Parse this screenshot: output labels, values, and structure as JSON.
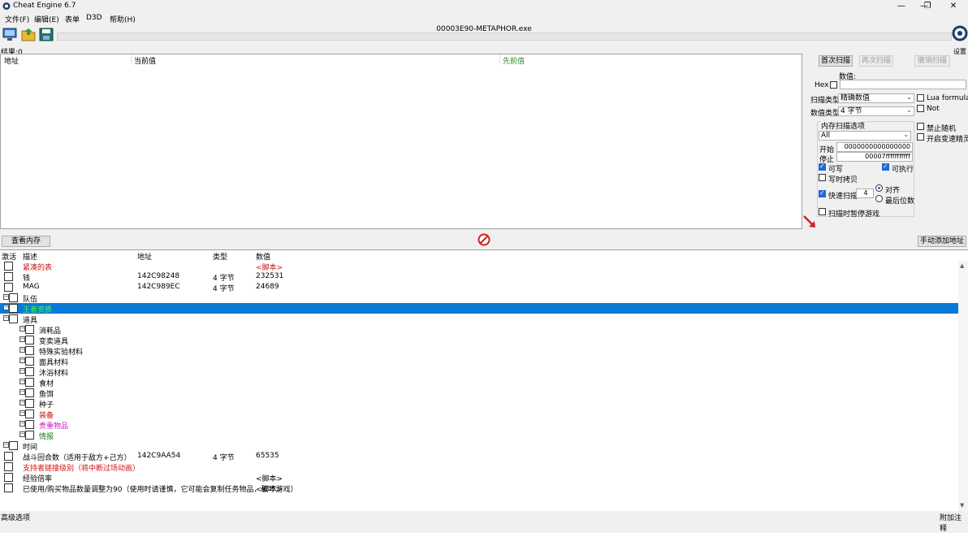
{
  "window": {
    "title": "Cheat Engine 6.7"
  },
  "menu": [
    "文件(F)",
    "编辑(E)",
    "表单",
    "D3D",
    "帮助(H)"
  ],
  "toolbar": {
    "process_name": "00003E90-METAPHOR.exe",
    "settings_label": "设置"
  },
  "results": {
    "count_label": "结果:0",
    "columns": [
      "地址",
      "当前值",
      "先前值"
    ]
  },
  "scan": {
    "first_scan": "首次扫描",
    "next_scan": "再次扫描",
    "undo_scan": "撤销扫描",
    "value_label": "数值:",
    "hex_label": "Hex",
    "scan_type_label": "扫描类型",
    "scan_type_value": "精确数值",
    "value_type_label": "数值类型",
    "value_type_value": "4 字节",
    "lua_formula": "Lua formula",
    "not_label": "Not",
    "no_random": "禁止随机",
    "speedhack": "开启变速精灵",
    "mem_options_title": "内存扫描选项",
    "mem_region": "All",
    "start_label": "开始",
    "start_value": "0000000000000000",
    "stop_label": "停止",
    "stop_value": "00007fffffffffff",
    "writable": "可写",
    "executable": "可执行",
    "copy_on_write": "写时拷贝",
    "fast_scan": "快速扫描",
    "fast_scan_value": "4",
    "align": "对齐",
    "last_digits": "最后位数",
    "pause_game": "扫描时暂停游戏"
  },
  "middle": {
    "view_memory": "查看内存",
    "add_address": "手动添加地址"
  },
  "address_list": {
    "columns": [
      "激活",
      "描述",
      "地址",
      "类型",
      "数值"
    ],
    "rows": [
      {
        "desc": "紧凑的表",
        "addr": "",
        "type": "",
        "value": "<脚本>",
        "color": "#d01010",
        "value_color": "#d01010",
        "expander": false,
        "indent": 0
      },
      {
        "desc": "钱",
        "addr": "142C98248",
        "type": "4 字节",
        "value": "232531",
        "color": "#000000",
        "value_color": "#000000",
        "expander": false,
        "indent": 0
      },
      {
        "desc": "MAG",
        "addr": "142C989EC",
        "type": "4 字节",
        "value": "24689",
        "color": "#000000",
        "value_color": "#000000",
        "expander": false,
        "indent": 0
      },
      {
        "desc": "队伍",
        "addr": "",
        "type": "",
        "value": "",
        "color": "#000000",
        "value_color": "#000000",
        "expander": true,
        "indent": 0
      },
      {
        "desc": "王者资质",
        "addr": "",
        "type": "",
        "value": "",
        "color": "#3cff3c",
        "value_color": "#000000",
        "expander": true,
        "indent": 0,
        "selected": true
      },
      {
        "desc": "道具",
        "addr": "",
        "type": "",
        "value": "",
        "color": "#000000",
        "value_color": "#000000",
        "expander": true,
        "indent": 0
      },
      {
        "desc": "消耗品",
        "addr": "",
        "type": "",
        "value": "",
        "color": "#000000",
        "value_color": "#000000",
        "expander": true,
        "indent": 1
      },
      {
        "desc": "变卖道具",
        "addr": "",
        "type": "",
        "value": "",
        "color": "#000000",
        "value_color": "#000000",
        "expander": true,
        "indent": 1
      },
      {
        "desc": "特殊实验材料",
        "addr": "",
        "type": "",
        "value": "",
        "color": "#000000",
        "value_color": "#000000",
        "expander": true,
        "indent": 1
      },
      {
        "desc": "面具材料",
        "addr": "",
        "type": "",
        "value": "",
        "color": "#000000",
        "value_color": "#000000",
        "expander": true,
        "indent": 1
      },
      {
        "desc": "沐浴材料",
        "addr": "",
        "type": "",
        "value": "",
        "color": "#000000",
        "value_color": "#000000",
        "expander": true,
        "indent": 1
      },
      {
        "desc": "食材",
        "addr": "",
        "type": "",
        "value": "",
        "color": "#000000",
        "value_color": "#000000",
        "expander": true,
        "indent": 1
      },
      {
        "desc": "鱼饵",
        "addr": "",
        "type": "",
        "value": "",
        "color": "#000000",
        "value_color": "#000000",
        "expander": true,
        "indent": 1
      },
      {
        "desc": "种子",
        "addr": "",
        "type": "",
        "value": "",
        "color": "#000000",
        "value_color": "#000000",
        "expander": true,
        "indent": 1
      },
      {
        "desc": "装备",
        "addr": "",
        "type": "",
        "value": "",
        "color": "#d01010",
        "value_color": "#000000",
        "expander": true,
        "indent": 1
      },
      {
        "desc": "贵重物品",
        "addr": "",
        "type": "",
        "value": "",
        "color": "#c020c0",
        "value_color": "#000000",
        "expander": true,
        "indent": 1
      },
      {
        "desc": "情报",
        "addr": "",
        "type": "",
        "value": "",
        "color": "#108010",
        "value_color": "#000000",
        "expander": true,
        "indent": 1
      },
      {
        "desc": "时间",
        "addr": "",
        "type": "",
        "value": "",
        "color": "#000000",
        "value_color": "#000000",
        "expander": true,
        "indent": 0
      },
      {
        "desc": "战斗回合数（适用于敌方+己方）",
        "addr": "142C9AA54",
        "type": "4 字节",
        "value": "65535",
        "color": "#000000",
        "value_color": "#000000",
        "expander": false,
        "indent": 0
      },
      {
        "desc": "支持者链接级别（将中断过场动画）",
        "addr": "",
        "type": "",
        "value": "",
        "color": "#d01010",
        "value_color": "#000000",
        "expander": false,
        "indent": 0
      },
      {
        "desc": "经验倍率",
        "addr": "",
        "type": "",
        "value": "<脚本>",
        "color": "#000000",
        "value_color": "#000000",
        "expander": false,
        "indent": 0
      },
      {
        "desc": "已使用/购买物品数量调整为90（使用时请谨慎，它可能会复制任务物品，破坏游戏）",
        "addr": "",
        "type": "",
        "value": "<脚本>",
        "color": "#000000",
        "value_color": "#000000",
        "expander": false,
        "indent": 0
      }
    ]
  },
  "status": {
    "advanced": "高级选项",
    "comments": "附加注释"
  }
}
